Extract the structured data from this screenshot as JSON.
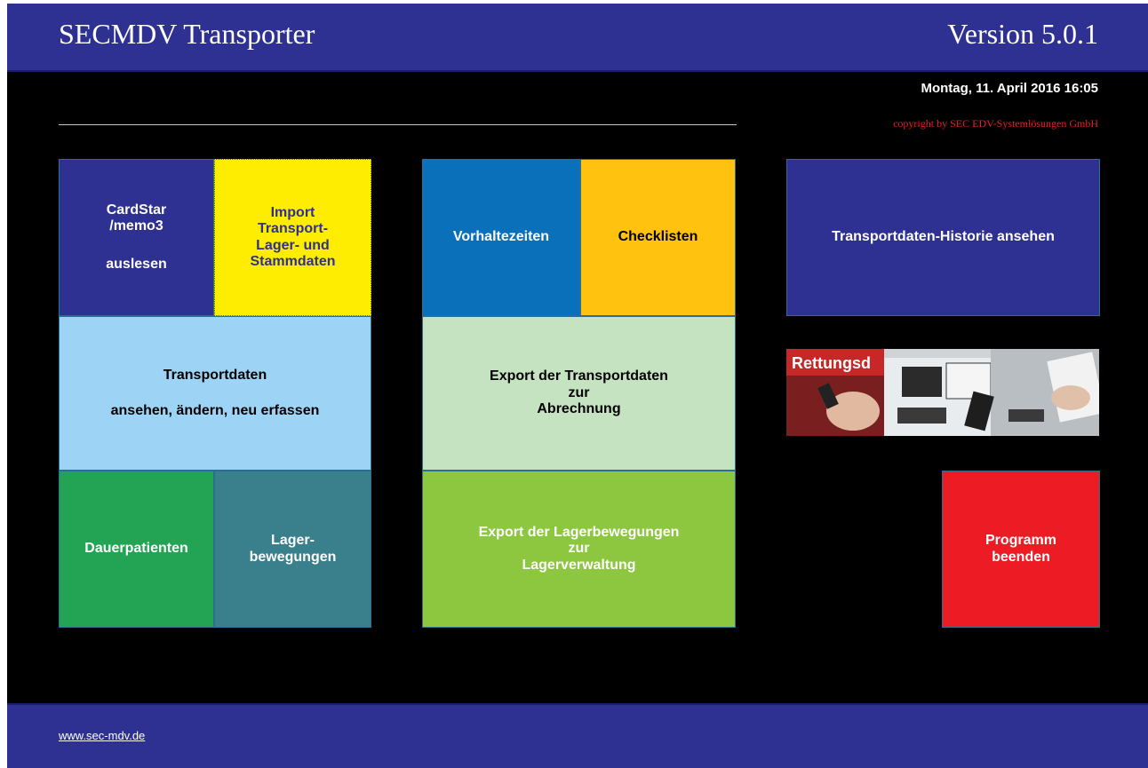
{
  "header": {
    "title": "SECMDV Transporter",
    "version": "Version 5.0.1"
  },
  "info": {
    "datetime": "Montag, 11. April 2016 16:05",
    "copyright": "copyright by SEC EDV-Systemlösungen GmbH"
  },
  "tiles": {
    "cardstar": {
      "line1": "CardStar",
      "line2": "/memo3",
      "line3": "auslesen"
    },
    "import": {
      "line1": "Import",
      "line2": "Transport-",
      "line3": "Lager- und",
      "line4": "Stammdaten"
    },
    "transportdaten": {
      "line1": "Transportdaten",
      "line2": "ansehen, ändern, neu erfassen"
    },
    "dauerpatienten": {
      "label": "Dauerpatienten"
    },
    "lagerbewegungen": {
      "line1": "Lager-",
      "line2": "bewegungen"
    },
    "vorhaltezeiten": {
      "label": "Vorhaltezeiten"
    },
    "checklisten": {
      "label": "Checklisten"
    },
    "export_transport": {
      "line1": "Export der Transportdaten",
      "line2": "zur",
      "line3": "Abrechnung"
    },
    "export_lager": {
      "line1": "Export der Lagerbewegungen",
      "line2": "zur",
      "line3": "Lagerverwaltung"
    },
    "historie": {
      "label": "Transportdaten-Historie ansehen"
    },
    "beenden": {
      "line1": "Programm",
      "line2": "beenden"
    }
  },
  "banner": {
    "text": "Rettungsd"
  },
  "footer": {
    "link": "www.sec-mdv.de"
  },
  "colors": {
    "header": "#2e3192",
    "navy_tile": "#2e3192",
    "yellow_tile": "#ffed00",
    "lightblue_tile": "#9dd4f6",
    "green_tile": "#23a455",
    "teal_tile": "#3a7f8c",
    "blue_tile": "#0a70b9",
    "orange_tile": "#ffc20e",
    "mint_tile": "#c5e3c1",
    "lime_tile": "#8dc63f",
    "red_tile": "#ed1c24"
  }
}
